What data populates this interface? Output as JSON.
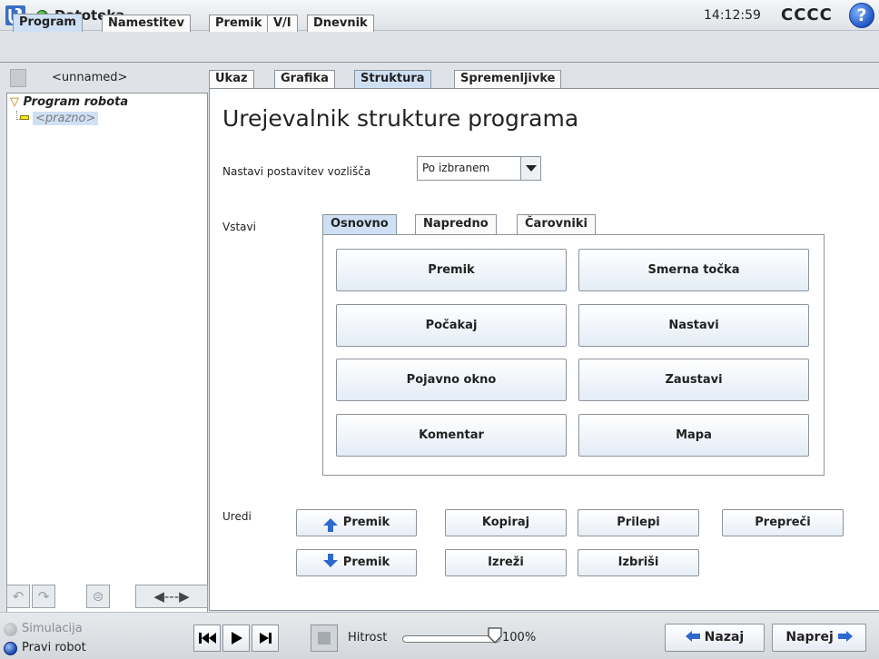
{
  "titlebar": {
    "title": "Datoteka",
    "time": "14:12:59",
    "robot_name": "CCCC",
    "help": "?"
  },
  "main_tabs": [
    "Program",
    "Namestitev",
    "Premik",
    "V/I",
    "Dnevnik"
  ],
  "program": {
    "name": "<unnamed>",
    "tree_root": "Program robota",
    "tree_child": "<prazno>"
  },
  "sub_tabs": [
    "Ukaz",
    "Grafika",
    "Struktura",
    "Spremenljivke"
  ],
  "editor": {
    "title": "Urejevalnik strukture programa",
    "layout_label": "Nastavi postavitev vozlišča",
    "layout_value": "Po izbranem",
    "insert_label": "Vstavi",
    "insert_tabs": [
      "Osnovno",
      "Napredno",
      "Čarovniki"
    ],
    "insert_buttons": [
      "Premik",
      "Smerna točka",
      "Počakaj",
      "Nastavi",
      "Pojavno okno",
      "Zaustavi",
      "Komentar",
      "Mapa"
    ],
    "edit_label": "Uredi",
    "edit_buttons": {
      "move_up": "Premik",
      "move_down": "Premik",
      "copy": "Kopiraj",
      "cut": "Izreži",
      "paste": "Prilepi",
      "delete": "Izbriši",
      "suppress": "Prepreči"
    }
  },
  "footer": {
    "simulation": "Simulacija",
    "real_robot": "Pravi robot",
    "speed_label": "Hitrost",
    "speed_value": "100%",
    "speed_fraction": 1.0,
    "back": "Nazaj",
    "next": "Naprej"
  },
  "colors": {
    "active_tab": "#cfe0f5",
    "accent_blue": "#2d6ad0",
    "status_green": "#1f8a1f"
  }
}
